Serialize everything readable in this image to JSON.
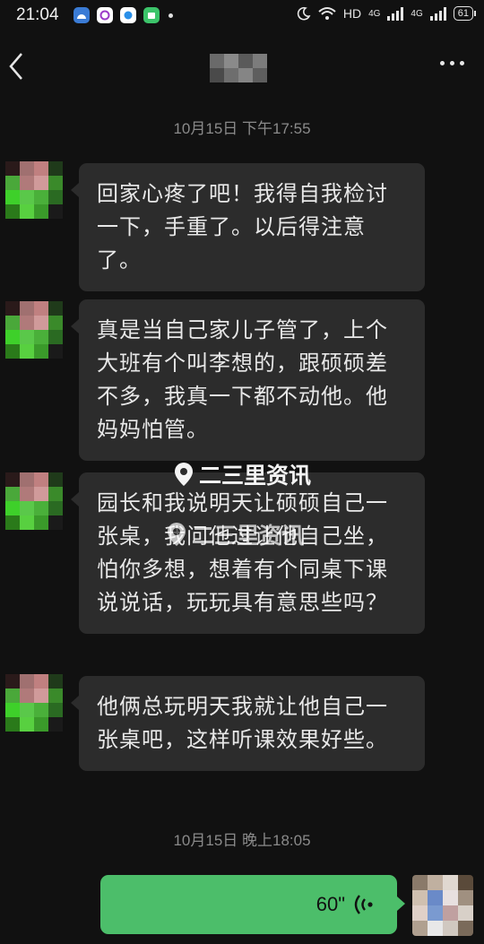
{
  "status_bar": {
    "time": "21:04",
    "network_label": "HD",
    "net_type_1": "4G",
    "net_type_2": "4G",
    "battery": "61"
  },
  "nav": {
    "back_icon": "chevron-left-icon",
    "more_icon": "more-dots-icon"
  },
  "timestamps": [
    "10月15日 下午17:55",
    "10月15日 晚上18:05"
  ],
  "messages": [
    {
      "text": "回家心疼了吧！我得自我检讨一下，手重了。以后得注意了。"
    },
    {
      "text": "真是当自己家儿子管了，上个大班有个叫李想的，跟硕硕差不多，我真一下都不动他。他妈妈怕管。"
    },
    {
      "text": "园长和我说明天让硕硕自己一张桌，我问他过让他自己坐，怕你多想，想着有个同桌下课说说话，玩玩具有意思些吗？"
    },
    {
      "text": "他俩总玩明天我就让他自己一张桌吧，这样听课效果好些。"
    }
  ],
  "voice_message": {
    "duration": "60\"",
    "icon": "voice-wave-icon"
  },
  "watermark": {
    "text_1": "二三里资讯",
    "text_2": "二三里资讯"
  },
  "colors": {
    "background": "#111111",
    "bubble": "#2c2c2c",
    "self_bubble": "#4cbe6a",
    "timestamp": "#8a8a8a"
  }
}
